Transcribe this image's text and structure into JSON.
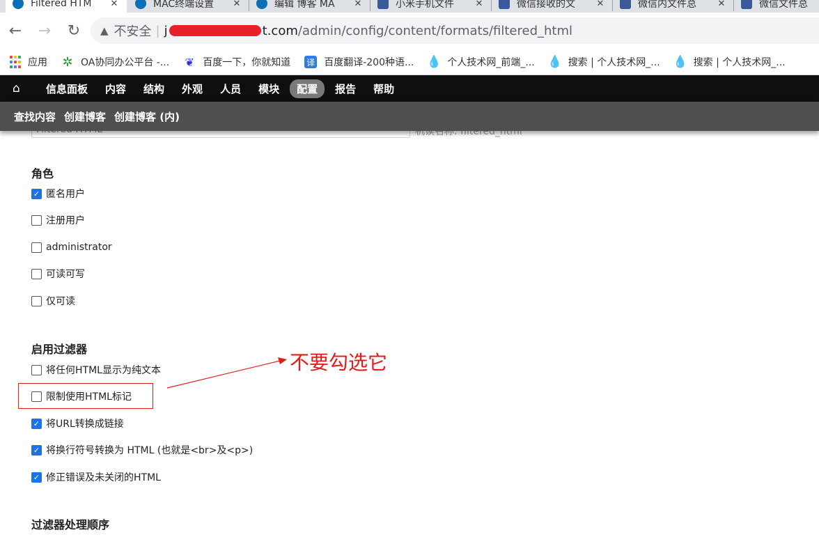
{
  "browser": {
    "tabs": [
      {
        "label": "Filtered HTM",
        "icon": "drupal-icon",
        "active": true
      },
      {
        "label": "MAC终端设置",
        "icon": "drupal-icon",
        "active": false
      },
      {
        "label": "编辑 博客 MA",
        "icon": "drupal-icon",
        "active": false
      },
      {
        "label": "小米手机文件",
        "icon": "csdn-icon",
        "active": false
      },
      {
        "label": "微信接收的文",
        "icon": "csdn-icon",
        "active": false
      },
      {
        "label": "微信内文件总",
        "icon": "csdn-icon",
        "active": false
      },
      {
        "label": "微信文件总",
        "icon": "csdn-icon",
        "active": false
      }
    ],
    "address": {
      "security_label": "不安全",
      "separator": "|",
      "url_prefix": "j",
      "domain_suffix": "t.com",
      "path": "/admin/config/content/formats/filtered_html"
    },
    "bookmarks": [
      {
        "label": "应用",
        "icon": "apps-grid-icon"
      },
      {
        "label": "OA协同办公平台 -...",
        "icon": "oa-gear-icon"
      },
      {
        "label": "百度一下，你就知道",
        "icon": "baidu-paw-icon"
      },
      {
        "label": "百度翻译-200种语...",
        "icon": "translate-icon"
      },
      {
        "label": "个人技术网_前端_...",
        "icon": "drupal-drop-icon"
      },
      {
        "label": "搜索 | 个人技术网_...",
        "icon": "drupal-drop-icon"
      },
      {
        "label": "搜索 | 个人技术网_...",
        "icon": "drupal-drop-icon"
      }
    ]
  },
  "admin_toolbar": {
    "items": [
      {
        "label": "信息面板",
        "active": false
      },
      {
        "label": "内容",
        "active": false
      },
      {
        "label": "结构",
        "active": false
      },
      {
        "label": "外观",
        "active": false
      },
      {
        "label": "人员",
        "active": false
      },
      {
        "label": "模块",
        "active": false
      },
      {
        "label": "配置",
        "active": true
      },
      {
        "label": "报告",
        "active": false
      },
      {
        "label": "帮助",
        "active": false
      }
    ],
    "shortcuts": [
      "查找内容",
      "创建博客",
      "创建博客 (内)"
    ]
  },
  "form": {
    "name_value": "Filtered HTML",
    "machine_name": "机读名称: filtered_html",
    "roles": {
      "title": "角色",
      "items": [
        {
          "label": "匿名用户",
          "checked": true
        },
        {
          "label": "注册用户",
          "checked": false
        },
        {
          "label": "administrator",
          "checked": false
        },
        {
          "label": "可读可写",
          "checked": false
        },
        {
          "label": "仅可读",
          "checked": false
        }
      ]
    },
    "filters": {
      "title": "启用过滤器",
      "items": [
        {
          "label": "将任何HTML显示为纯文本",
          "checked": false
        },
        {
          "label": "限制使用HTML标记",
          "checked": false
        },
        {
          "label": "将URL转换成链接",
          "checked": true
        },
        {
          "label": "将换行符号转换为 HTML (也就是<br>及<p>)",
          "checked": true
        },
        {
          "label": "修正错误及未关闭的HTML",
          "checked": true
        }
      ]
    },
    "order_title": "过滤器处理顺序"
  },
  "annotation": {
    "text": "不要勾选它",
    "color": "#e21b1b"
  },
  "colors": {
    "checkbox_checked": "#1a73e8",
    "admin_toolbar_bg": "#0f0f0f",
    "shortcut_bar_bg": "#4f4f4f"
  }
}
